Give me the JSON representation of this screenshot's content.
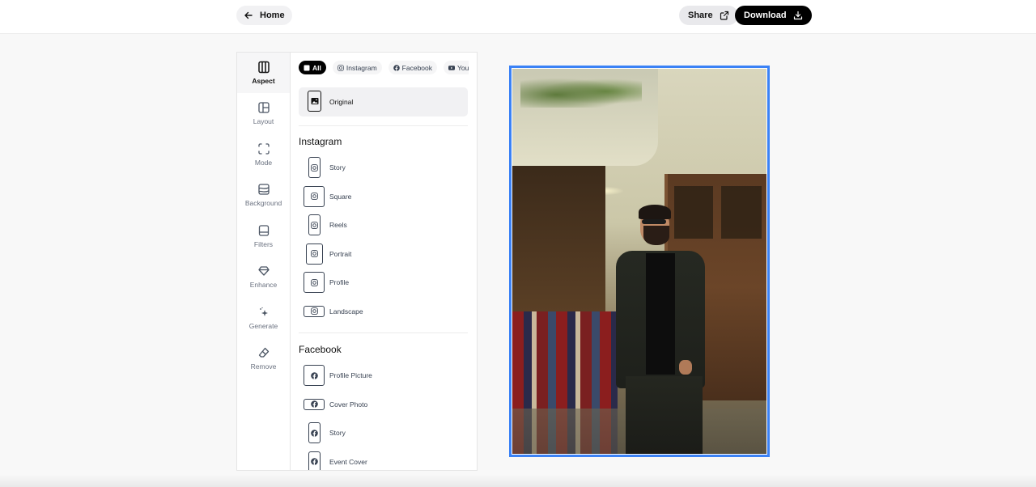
{
  "header": {
    "home_label": "Home",
    "share_label": "Share",
    "download_label": "Download"
  },
  "rail": {
    "items": [
      {
        "label": "Aspect",
        "icon": "columns-icon",
        "active": true
      },
      {
        "label": "Layout",
        "icon": "layout-icon",
        "active": false
      },
      {
        "label": "Mode",
        "icon": "frame-corners-icon",
        "active": false
      },
      {
        "label": "Background",
        "icon": "background-icon",
        "active": false
      },
      {
        "label": "Filters",
        "icon": "filters-icon",
        "active": false
      },
      {
        "label": "Enhance",
        "icon": "diamond-icon",
        "active": false
      },
      {
        "label": "Generate",
        "icon": "sparkles-icon",
        "active": false
      },
      {
        "label": "Remove",
        "icon": "eraser-icon",
        "active": false
      }
    ]
  },
  "filters": {
    "chips": [
      {
        "label": "All",
        "icon": "square-icon",
        "active": true
      },
      {
        "label": "Instagram",
        "icon": "instagram-icon",
        "active": false
      },
      {
        "label": "Facebook",
        "icon": "facebook-icon",
        "active": false
      },
      {
        "label": "YouT",
        "icon": "youtube-icon",
        "active": false
      }
    ]
  },
  "original": {
    "label": "Original",
    "icon": "image-icon"
  },
  "sections": [
    {
      "title": "Instagram",
      "icon": "instagram-icon",
      "options": [
        {
          "label": "Story",
          "shape": "tall"
        },
        {
          "label": "Square",
          "shape": "square"
        },
        {
          "label": "Reels",
          "shape": "tall"
        },
        {
          "label": "Portrait",
          "shape": "portrait"
        },
        {
          "label": "Profile",
          "shape": "square"
        },
        {
          "label": "Landscape",
          "shape": "wide"
        }
      ]
    },
    {
      "title": "Facebook",
      "icon": "facebook-icon",
      "options": [
        {
          "label": "Profile Picture",
          "shape": "square"
        },
        {
          "label": "Cover Photo",
          "shape": "wide"
        },
        {
          "label": "Story",
          "shape": "tall"
        },
        {
          "label": "Event Cover",
          "shape": "tall"
        }
      ]
    }
  ],
  "canvas": {
    "selection_color": "#3b82f6",
    "image_description": "Man in dark suit and sunglasses walking past rugs in an old street"
  }
}
